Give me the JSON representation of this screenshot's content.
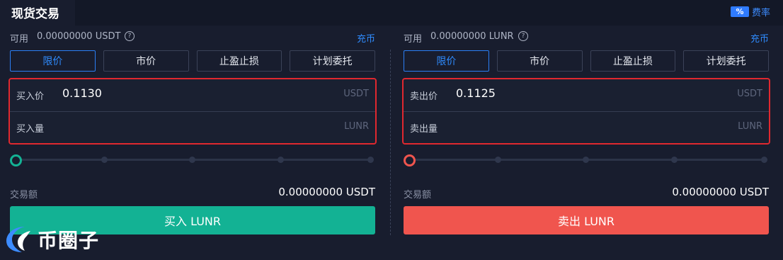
{
  "header": {
    "title": "现货交易",
    "fee_icon": "%",
    "fee_label": "费率"
  },
  "colors": {
    "accent": "#2f8cff",
    "buy": "#13b294",
    "sell": "#f0554e",
    "highlight": "#e0282f"
  },
  "buy_panel": {
    "available_label": "可用",
    "available_value": "0.00000000 USDT",
    "deposit_label": "充币",
    "tabs": [
      "限价",
      "市价",
      "止盈止损",
      "计划委托"
    ],
    "active_tab": 0,
    "price_label": "买入价",
    "price_value": "0.1130",
    "price_unit": "USDT",
    "quantity_label": "买入量",
    "quantity_unit": "LUNR",
    "slider_percent": 0,
    "amount_label": "交易额",
    "amount_value": "0.00000000 USDT",
    "action_label": "买入 LUNR"
  },
  "sell_panel": {
    "available_label": "可用",
    "available_value": "0.00000000 LUNR",
    "deposit_label": "充币",
    "tabs": [
      "限价",
      "市价",
      "止盈止损",
      "计划委托"
    ],
    "active_tab": 0,
    "price_label": "卖出价",
    "price_value": "0.1125",
    "price_unit": "USDT",
    "quantity_label": "卖出量",
    "quantity_unit": "LUNR",
    "slider_percent": 0,
    "amount_label": "交易额",
    "amount_value": "0.00000000 USDT",
    "action_label": "卖出 LUNR"
  },
  "watermark": {
    "text": "币圈子"
  }
}
